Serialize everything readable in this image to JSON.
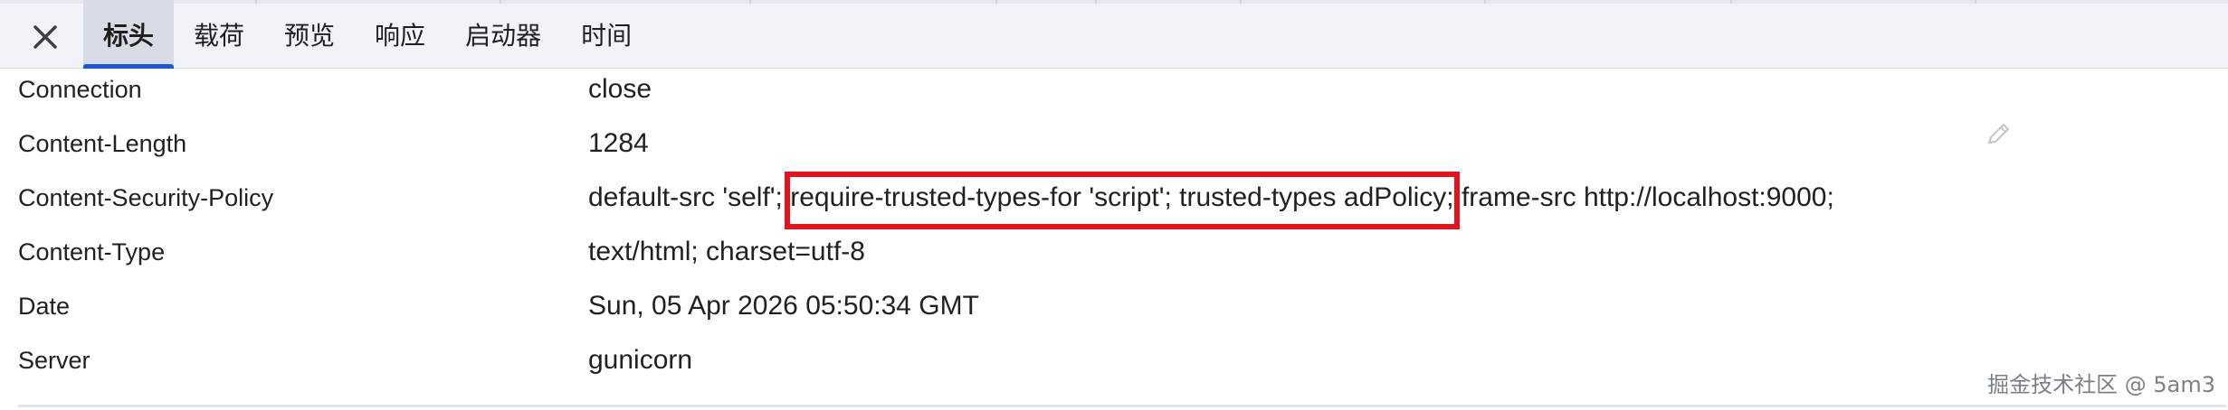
{
  "tabs": [
    {
      "label": "标头",
      "active": true
    },
    {
      "label": "载荷",
      "active": false
    },
    {
      "label": "预览",
      "active": false
    },
    {
      "label": "响应",
      "active": false
    },
    {
      "label": "启动器",
      "active": false
    },
    {
      "label": "时间",
      "active": false
    }
  ],
  "headers": [
    {
      "name": "Connection",
      "value": "close"
    },
    {
      "name": "Content-Length",
      "value": "1284"
    },
    {
      "name": "Content-Security-Policy",
      "value_before": "default-src 'self';",
      "value_highlight": "require-trusted-types-for 'script'; trusted-types adPolicy;",
      "value_after": "frame-src http://localhost:9000;"
    },
    {
      "name": "Content-Type",
      "value": "text/html; charset=utf-8"
    },
    {
      "name": "Date",
      "value": "Sun, 05 Apr 2026 05:50:34 GMT"
    },
    {
      "name": "Server",
      "value": "gunicorn"
    }
  ],
  "watermark": "掘金技术社区 @ 5am3",
  "colors": {
    "tab_bar_bg": "#f1f3f9",
    "active_tab_bg": "#d8dce6",
    "active_tab_underline": "#1a57d8",
    "highlight_box": "#e8101d"
  }
}
